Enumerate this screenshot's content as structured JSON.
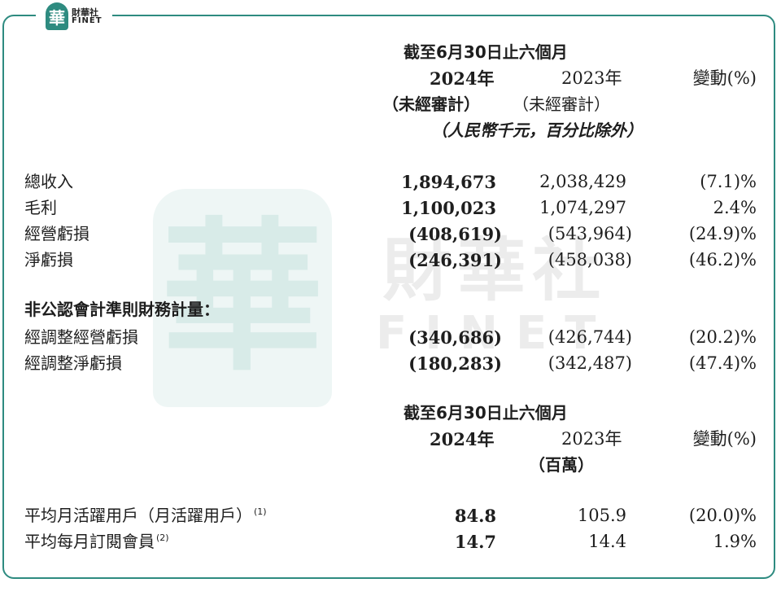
{
  "brand": {
    "seal_char": "華",
    "name_cn": "財華社",
    "name_en": "FINET",
    "color": "#2e8b80"
  },
  "watermark": {
    "seal_char": "華",
    "name_cn": "財華社",
    "name_en": "FINET"
  },
  "section1": {
    "period": "截至6月30日止六個月",
    "col_2024": "2024年",
    "col_2023": "2023年",
    "col_change": "變動(%)",
    "audit_2024": "（未經審計）",
    "audit_2023": "（未經審計）",
    "unit": "（人民幣千元，百分比除外）",
    "rows": [
      {
        "label": "總收入",
        "v2024": "1,894,673",
        "v2023": "2,038,429",
        "change": "(7.1)%"
      },
      {
        "label": "毛利",
        "v2024": "1,100,023",
        "v2023": "1,074,297",
        "change": "2.4%"
      },
      {
        "label": "經營虧損",
        "v2024": "(408,619)",
        "v2023": "(543,964)",
        "change": "(24.9)%"
      },
      {
        "label": "淨虧損",
        "v2024": "(246,391)",
        "v2023": "(458,038)",
        "change": "(46.2)%"
      }
    ],
    "nongaap_title": "非公認會計準則財務計量：",
    "nongaap_rows": [
      {
        "label": "經調整經營虧損",
        "v2024": "(340,686)",
        "v2023": "(426,744)",
        "change": "(20.2)%"
      },
      {
        "label": "經調整淨虧損",
        "v2024": "(180,283)",
        "v2023": "(342,487)",
        "change": "(47.4)%"
      }
    ]
  },
  "section2": {
    "period": "截至6月30日止六個月",
    "col_2024": "2024年",
    "col_2023": "2023年",
    "col_change": "變動(%)",
    "unit": "（百萬）",
    "rows": [
      {
        "label": "平均月活躍用戶（月活躍用戶）",
        "note": "(1)",
        "v2024": "84.8",
        "v2023": "105.9",
        "change": "(20.0)%"
      },
      {
        "label": "平均每月訂閱會員",
        "note": "(2)",
        "v2024": "14.7",
        "v2023": "14.4",
        "change": "1.9%"
      }
    ]
  }
}
